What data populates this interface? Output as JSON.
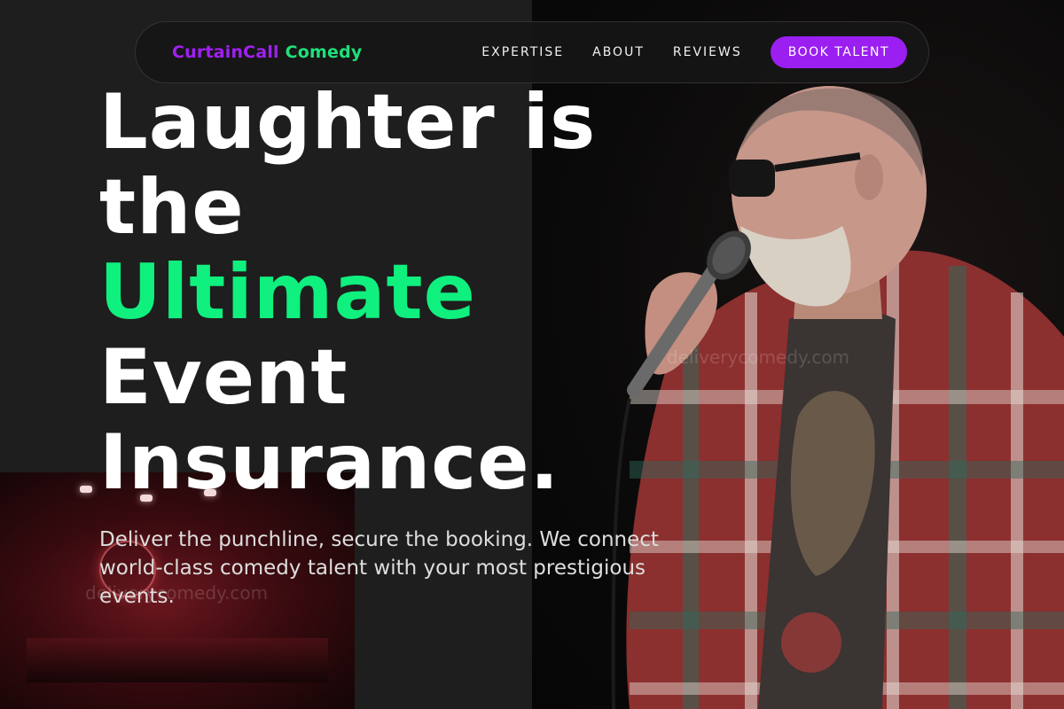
{
  "brand": {
    "name_part1": "CurtainCall",
    "name_part2": "Comedy",
    "color_part1": "#a020f0",
    "color_part2": "#1ee07a"
  },
  "nav": {
    "links": [
      "EXPERTISE",
      "ABOUT",
      "REVIEWS"
    ],
    "cta_label": "BOOK TALENT",
    "cta_color": "#9b1ff0"
  },
  "hero": {
    "headline_lines": [
      "Laughter is",
      "the",
      "Ultimate",
      "Event",
      "Insurance."
    ],
    "accent_line": "Ultimate",
    "accent_color": "#0ff07e",
    "subtitle": "Deliver the punchline, secure the booking. We connect world-class comedy talent with your most prestigious events."
  },
  "images": {
    "performer_watermark": "deliverycomedy.com",
    "venue_watermark": "deliverycomedy.com"
  },
  "icons": [
    "microphone-icon",
    "neon-sign-icon"
  ]
}
